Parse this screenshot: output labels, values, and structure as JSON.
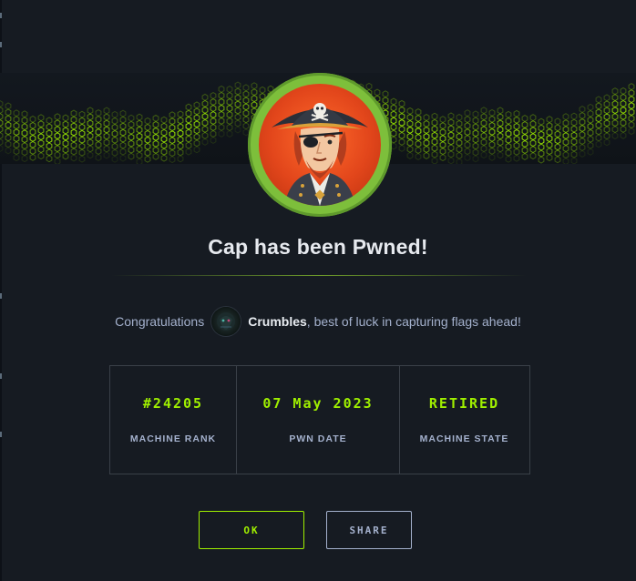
{
  "machine": {
    "name": "Cap",
    "title": "Cap has been Pwned!"
  },
  "congrats": {
    "prefix": "Congratulations",
    "username": "Crumbles",
    "suffix": ", best of luck in capturing flags ahead!"
  },
  "stats": [
    {
      "value": "#24205",
      "label": "MACHINE RANK"
    },
    {
      "value": "07 May 2023",
      "label": "PWN DATE"
    },
    {
      "value": "RETIRED",
      "label": "MACHINE STATE"
    }
  ],
  "buttons": {
    "ok": "OK",
    "share": "SHARE"
  },
  "icons": {
    "machine_avatar": "pirate-captain-icon",
    "user_avatar": "user-avatar-icon",
    "banner": "green-hex-wave-banner"
  },
  "colors": {
    "accent": "#9fef00",
    "background": "#161b22",
    "text_muted": "#a4b1cd",
    "border": "#3a4048"
  }
}
